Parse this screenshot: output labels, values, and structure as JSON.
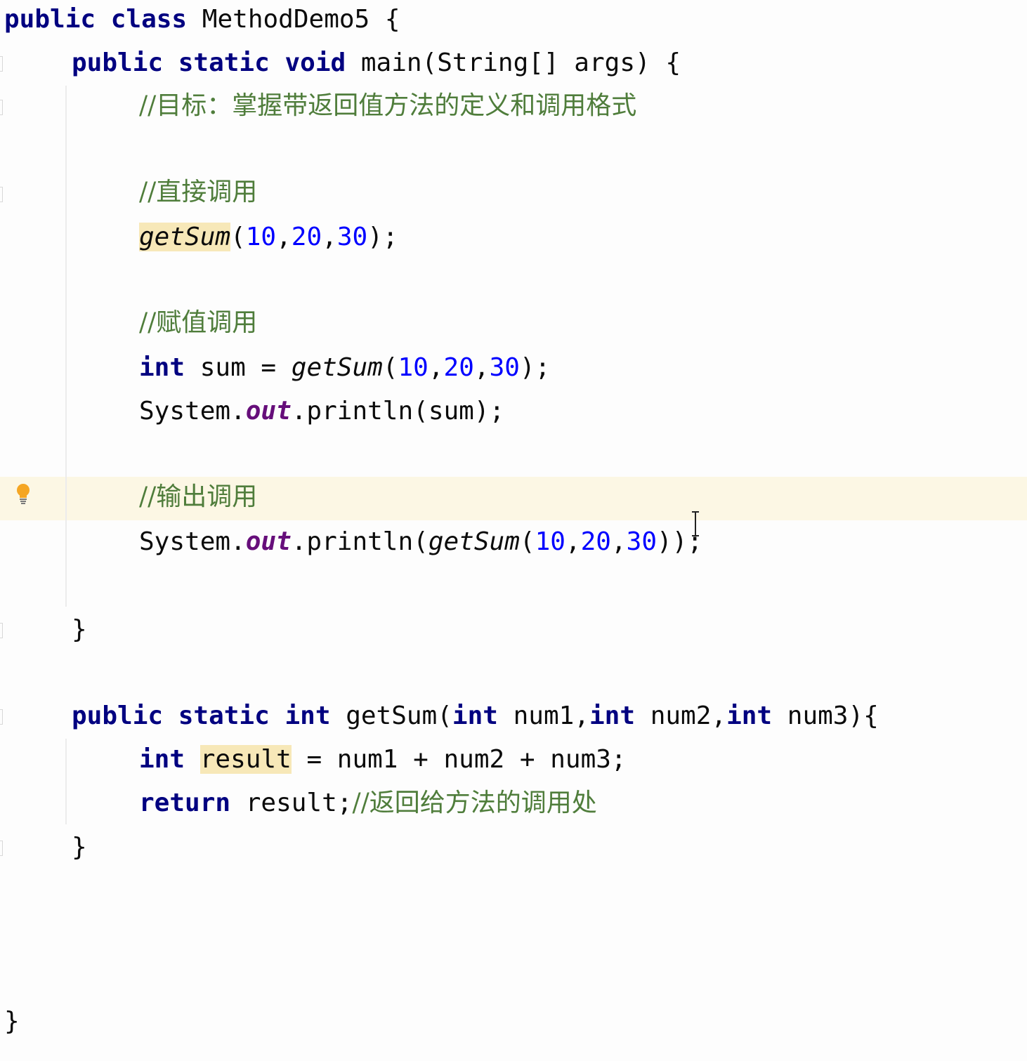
{
  "code": {
    "class_decl": {
      "kw1": "public",
      "kw2": "class",
      "name": "MethodDemo5",
      "brace": "{"
    },
    "main_decl": {
      "kw1": "public",
      "kw2": "static",
      "kw3": "void",
      "rest": "main(String[] args) {"
    },
    "comment_goal": "//目标：掌握带返回值方法的定义和调用格式",
    "comment_direct": "//直接调用",
    "direct_call": {
      "method": "getSum",
      "open": "(",
      "a": "10",
      "c1": ",",
      "b": "20",
      "c2": ",",
      "c": "30",
      "close": ");"
    },
    "comment_assign": "//赋值调用",
    "assign_call": {
      "kw": "int",
      "var": "sum = ",
      "method": "getSum",
      "open": "(",
      "a": "10",
      "c1": ",",
      "b": "20",
      "c2": ",",
      "c": "30",
      "close": ");"
    },
    "print_sum": {
      "system": "System.",
      "out": "out",
      "rest": ".println(sum);"
    },
    "comment_print": "//输出调用",
    "print_call": {
      "system": "System.",
      "out": "out",
      "mid": ".println(",
      "method": "getSum",
      "open": "(",
      "a": "10",
      "c1": ",",
      "b": "20",
      "c2": ",",
      "c": "30",
      "close": "));"
    },
    "main_close": "}",
    "getsum_decl": {
      "kw1": "public",
      "kw2": "static",
      "kw3": "int",
      "name": "getSum(",
      "p1kw": "int",
      "p1": " num1,",
      "p2kw": "int",
      "p2": " num2,",
      "p3kw": "int",
      "p3": " num3){"
    },
    "result_line": {
      "kw": "int",
      "var": "result",
      "rest": " = num1 + num2 + num3;"
    },
    "return_line": {
      "kw": "return",
      "rest": " result;",
      "comment": "//返回给方法的调用处"
    },
    "getsum_close": "}",
    "class_close": "}"
  },
  "icons": {
    "bulb": "intention-bulb-icon",
    "cursor": "text-cursor-icon"
  },
  "colors": {
    "keyword": "#000080",
    "number": "#0000ff",
    "comment": "#4f7d3b",
    "static_field": "#660e7a",
    "highlight": "#f7e8b8",
    "caret_row": "#fcf7e4",
    "bulb": "#f5a623"
  }
}
